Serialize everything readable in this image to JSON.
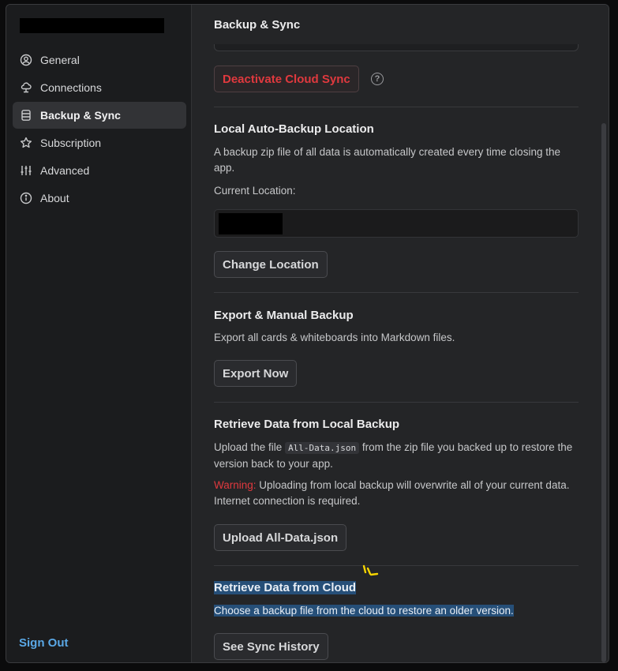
{
  "sidebar": {
    "items": [
      {
        "label": "General",
        "icon": "user-circle-icon"
      },
      {
        "label": "Connections",
        "icon": "cloud-connection-icon"
      },
      {
        "label": "Backup & Sync",
        "icon": "database-icon"
      },
      {
        "label": "Subscription",
        "icon": "star-icon"
      },
      {
        "label": "Advanced",
        "icon": "sliders-icon"
      },
      {
        "label": "About",
        "icon": "info-icon"
      }
    ],
    "active_index": 2,
    "sign_out": "Sign Out"
  },
  "header": {
    "title": "Backup & Sync"
  },
  "cloud_sync": {
    "deactivate_label": "Deactivate Cloud Sync",
    "help_glyph": "?"
  },
  "local_backup": {
    "title": "Local Auto-Backup Location",
    "description": "A backup zip file of all data is automatically created every time closing the app.",
    "current_location_label": "Current Location:",
    "change_button": "Change Location"
  },
  "export": {
    "title": "Export & Manual Backup",
    "description": "Export all cards & whiteboards into Markdown files.",
    "button": "Export Now"
  },
  "retrieve_local": {
    "title": "Retrieve Data from Local Backup",
    "description_pre": "Upload the file ",
    "file_name": "All-Data.json",
    "description_post": " from the zip file you backed up to restore the version back to your app.",
    "warning_label": "Warning:",
    "warning_text": " Uploading from local backup will overwrite all of your current data. Internet connection is required.",
    "button": "Upload All-Data.json"
  },
  "retrieve_cloud": {
    "title": "Retrieve Data from Cloud",
    "description": "Choose a backup file from the cloud to restore an older version.",
    "button": "See Sync History"
  },
  "colors": {
    "accent_link": "#5aa8e6",
    "danger": "#e0393e",
    "selection": "#264f78",
    "background": "#242527",
    "sidebar": "#1b1c1e"
  }
}
